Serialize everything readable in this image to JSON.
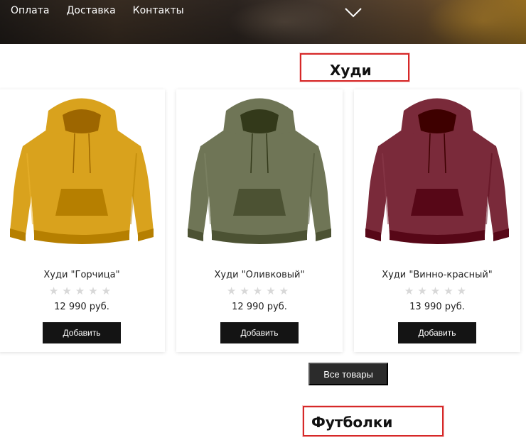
{
  "nav": {
    "items": [
      {
        "label": "Оплата"
      },
      {
        "label": "Доставка"
      },
      {
        "label": "Контакты"
      }
    ]
  },
  "sections": {
    "hoodie_title": "Худи",
    "tees_title": "Футболки"
  },
  "products": [
    {
      "name": "Худи \"Горчица\"",
      "stars": "★★★★★",
      "rating": 0,
      "price": "12 990 руб.",
      "button": "Добавить",
      "color": "#d9a21d"
    },
    {
      "name": "Худи \"Оливковый\"",
      "stars": "★★★★★",
      "rating": 0,
      "price": "12 990 руб.",
      "button": "Добавить",
      "color": "#6f7556"
    },
    {
      "name": "Худи \"Винно-красный\"",
      "stars": "★★★★★",
      "rating": 0,
      "price": "13 990 руб.",
      "button": "Добавить",
      "color": "#7a2a3a"
    }
  ],
  "all_products_button": "Все товары",
  "icons": {
    "scroll_down": "chevron-down-icon"
  },
  "colors": {
    "highlight": "#d62828",
    "button": "#141414",
    "star_empty": "#d8d8d8"
  }
}
